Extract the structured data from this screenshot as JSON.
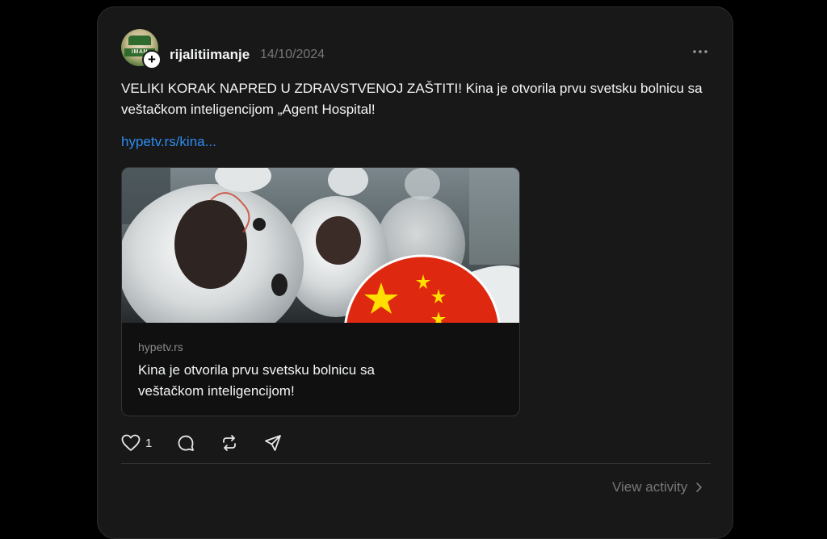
{
  "post": {
    "username": "rijalitiimanje",
    "date": "14/10/2024",
    "avatar_text": "IMAN",
    "more_label": "…",
    "text": "VELIKI KORAK NAPRED U ZDRAVSTVENOJ ZAŠTITI! Kina je otvorila prvu svetsku bolnicu sa veštačkom inteligencijom „Agent Hospital!",
    "link_text": "hypetv.rs/kina..."
  },
  "preview": {
    "domain": "hypetv.rs",
    "title": "Kina je otvorila prvu svetsku bolnicu sa veštačkom inteligencijom!",
    "image_icon": "robots-and-china-flag-image"
  },
  "actions": {
    "like_icon": "heart-icon",
    "like_count": "1",
    "reply_icon": "comment-icon",
    "repost_icon": "repost-icon",
    "share_icon": "send-icon"
  },
  "footer": {
    "view_activity_label": "View activity",
    "chevron_icon": "chevron-right-icon"
  },
  "colors": {
    "background": "#000000",
    "card": "#181818",
    "link": "#2d8cf0",
    "muted": "#777777",
    "flag_red": "#de2910",
    "flag_yellow": "#ffde00"
  }
}
